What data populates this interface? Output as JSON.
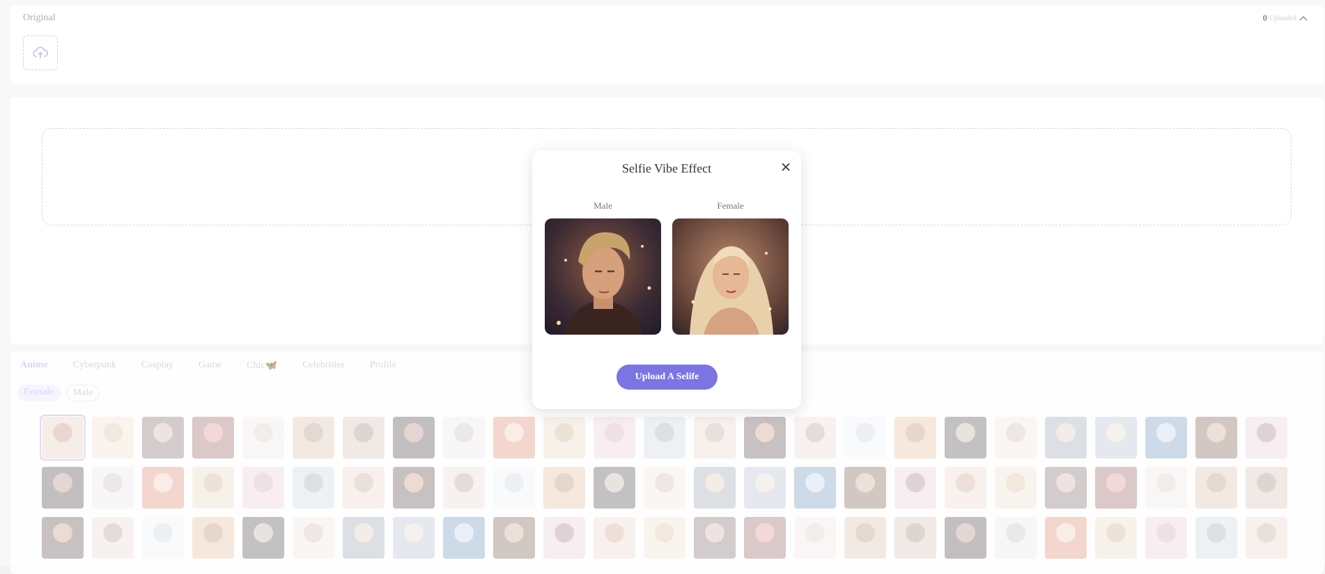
{
  "top": {
    "title": "Original",
    "upload_icon": "cloud-upload-icon",
    "uploaded_count": "0",
    "uploaded_label": "Uploaded",
    "collapse_icon": "chevron-up-icon"
  },
  "tabs": [
    "Anime",
    "Cyberpunk",
    "Cosplay",
    "Game",
    "Chic🦋",
    "Celebrities",
    "Profile"
  ],
  "active_tab": "Anime",
  "gender_filters": [
    "Female",
    "Male"
  ],
  "active_gender": "Female",
  "thumbnail_rows": 3,
  "thumbnails_per_row": 25,
  "modal": {
    "title": "Selfie Vibe Effect",
    "close_icon": "close-icon",
    "male_label": "Male",
    "female_label": "Female",
    "upload_button": "Upload A Selife"
  },
  "colors": {
    "accent": "#7b74e3",
    "accent_light": "#b9b3f0",
    "dashed_border": "#b3adf0"
  }
}
